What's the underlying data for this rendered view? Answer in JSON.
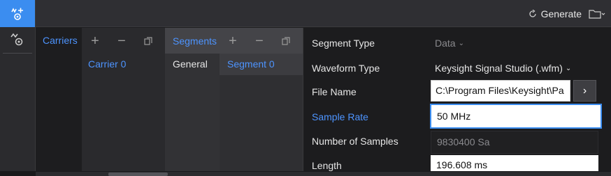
{
  "icons": {
    "rail_top": "waveform-generator-icon",
    "rail_second": "signal-settings-icon",
    "generate": "refresh-icon",
    "folder": "folder-open-icon",
    "add": "+",
    "remove": "−",
    "copy": "copy-icon",
    "browse": "›",
    "chevron": "⌄"
  },
  "toolbar": {
    "generate_label": "Generate"
  },
  "carriers": {
    "label": "Carriers",
    "items": [
      "Carrier 0"
    ]
  },
  "segments": {
    "label": "Segments",
    "general_label": "General",
    "items": [
      "Segment 0"
    ]
  },
  "properties": {
    "segment_type": {
      "label": "Segment Type",
      "value": "Data"
    },
    "waveform_type": {
      "label": "Waveform Type",
      "value": "Keysight Signal Studio (.wfm)"
    },
    "file_name": {
      "label": "File Name",
      "value": "C:\\Program Files\\Keysight\\Pa"
    },
    "sample_rate": {
      "label": "Sample Rate",
      "value": "50 MHz"
    },
    "num_samples": {
      "label": "Number of Samples",
      "value": "9830400 Sa"
    },
    "length": {
      "label": "Length",
      "value": "196.608 ms"
    }
  },
  "colors": {
    "accent": "#3b8df0",
    "link": "#4d94ff",
    "background": "#1e1e20"
  }
}
